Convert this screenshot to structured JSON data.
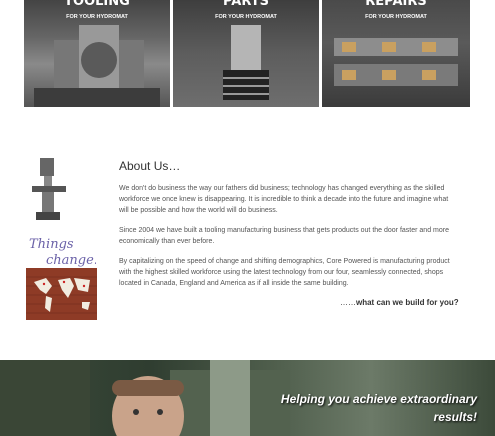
{
  "tiles": [
    {
      "title": "TOOLING",
      "subtitle": "FOR YOUR HYDROMAT",
      "icon": "tooling-photo"
    },
    {
      "title": "PARTS",
      "subtitle": "FOR YOUR HYDROMAT",
      "icon": "parts-photo"
    },
    {
      "title": "REPAIRS",
      "subtitle": "FOR YOUR HYDROMAT",
      "icon": "repairs-photo"
    }
  ],
  "about": {
    "title": "About Us…",
    "paragraphs": [
      "We don't do business the way our fathers did business; technology has changed everything as the skilled workforce we once knew is disappearing. It is incredible to think a decade into the future and imagine what will be possible and how the world will do business.",
      "Since 2004 we have built a tooling manufacturing business that gets products out the door faster and more economically than ever before.",
      "By capitalizing on the speed of change and shifting demographics, Core Powered is manufacturing product with the highest skilled workforce using the latest technology from our four, seamlessly connected, shops located in Canada, England and America as if all inside the same building."
    ],
    "cta_dots": "……",
    "cta": "what can we build for you?"
  },
  "side_images": {
    "machine": "milling-machine-image",
    "handwriting": "Things change.",
    "map": "world-map-brick-image"
  },
  "banner": {
    "text": "Helping you achieve extraordinary results!"
  }
}
